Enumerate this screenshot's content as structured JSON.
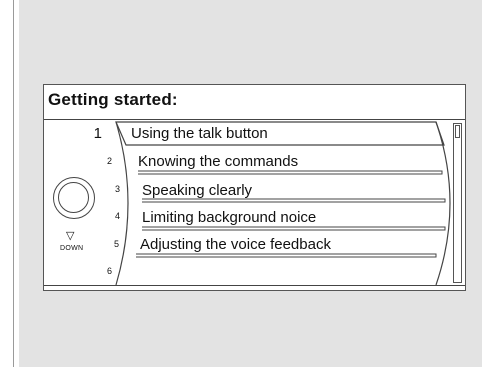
{
  "screen": {
    "title": "Getting started:",
    "knob_label": "DOWN",
    "items": [
      {
        "number": "1",
        "label": "Using the talk button",
        "selected": true
      },
      {
        "number": "2",
        "label": "Knowing the commands",
        "selected": false
      },
      {
        "number": "3",
        "label": "Speaking clearly",
        "selected": false
      },
      {
        "number": "4",
        "label": "Limiting background noice",
        "selected": false
      },
      {
        "number": "5",
        "label": "Adjusting the voice feedback",
        "selected": false
      },
      {
        "number": "6",
        "label": "",
        "selected": false
      }
    ]
  },
  "icons": {
    "knob": "rotary-knob-icon",
    "down": "down-triangle-icon"
  },
  "colors": {
    "panel": "#e3e3e3",
    "screen": "#ffffff",
    "line": "#444444"
  }
}
